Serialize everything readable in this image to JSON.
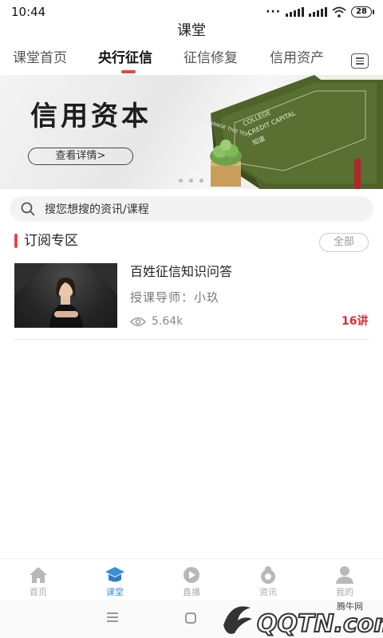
{
  "status_bar": {
    "time": "10:44",
    "battery": "28"
  },
  "header": {
    "title": "课堂"
  },
  "tabs": [
    {
      "label": "课堂首页",
      "active": false
    },
    {
      "label": "央行征信",
      "active": true
    },
    {
      "label": "征信修复",
      "active": false
    },
    {
      "label": "信用资产",
      "active": false
    }
  ],
  "banner": {
    "title": "信用资本",
    "button_label": "查看详情>",
    "book_cover_lines": [
      "COLLEGE",
      "CREDIT CAPITAL",
      "知道"
    ],
    "book_spine": "CHANGE THIS TEXT"
  },
  "search": {
    "placeholder": "搜您想搜的资讯/课程"
  },
  "section": {
    "title": "订阅专区",
    "all_label": "全部"
  },
  "courses": [
    {
      "title": "百姓征信知识问答",
      "teacher": "授课导师：小玖",
      "views": "5.64k",
      "lessons": "16讲"
    }
  ],
  "bottom_nav": [
    {
      "label": "首页",
      "icon": "home-icon",
      "active": false
    },
    {
      "label": "课堂",
      "icon": "classroom-icon",
      "active": true
    },
    {
      "label": "直播",
      "icon": "live-play-icon",
      "active": false
    },
    {
      "label": "资讯",
      "icon": "news-icon",
      "active": false
    },
    {
      "label": "我的",
      "icon": "profile-icon",
      "active": false
    }
  ],
  "watermark": {
    "text": "腾牛网",
    "logo_text": "QQTN.com"
  },
  "colors": {
    "accent": "#e8434a",
    "nav_active": "#3a8fd8",
    "lesson_count": "#d9303a",
    "book_green": "#55692f"
  }
}
